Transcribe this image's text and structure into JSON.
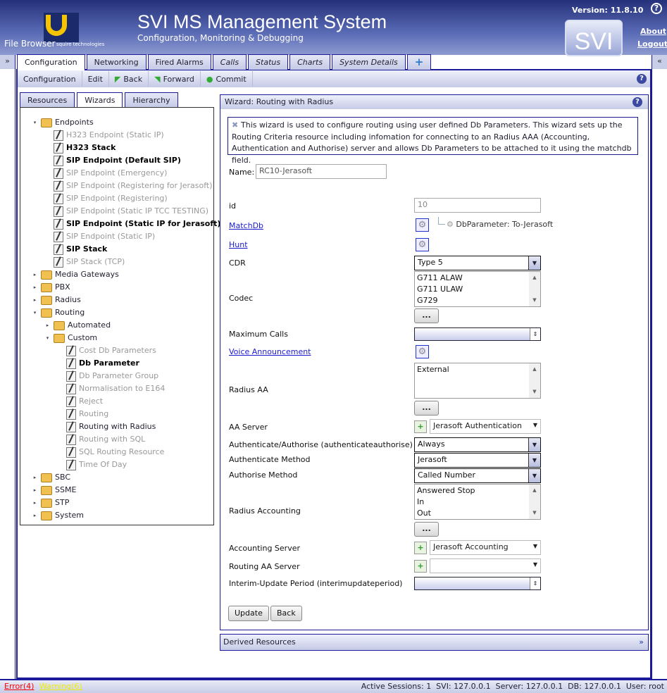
{
  "header": {
    "title": "SVI MS Management System",
    "subtitle": "Configuration, Monitoring & Debugging",
    "file_browser": "File Browser",
    "version": "Version: 11.8.10",
    "about": "About",
    "logout": "Logout",
    "logo_text": "SVI",
    "brand": "squire technologies"
  },
  "gutter": {
    "left": "»",
    "right": "«"
  },
  "tabs": [
    {
      "label": "Configuration"
    },
    {
      "label": "Networking"
    },
    {
      "label": "Fired Alarms"
    },
    {
      "label": "Calls"
    },
    {
      "label": "Status"
    },
    {
      "label": "Charts"
    },
    {
      "label": "System Details"
    },
    {
      "label": "+"
    }
  ],
  "toolbar": {
    "configuration": "Configuration",
    "edit": "Edit",
    "back": "Back",
    "forward": "Forward",
    "commit": "Commit",
    "help": "?"
  },
  "left_tabs": [
    {
      "label": "Resources"
    },
    {
      "label": "Wizards"
    },
    {
      "label": "Hierarchy"
    }
  ],
  "tree": [
    {
      "label": "Endpoints",
      "level": 0,
      "type": "folder",
      "toggle": "▾",
      "style": "dark"
    },
    {
      "label": "H323 Endpoint (Static IP)",
      "level": 1,
      "type": "wizard",
      "style": "grey"
    },
    {
      "label": "H323 Stack",
      "level": 1,
      "type": "wizard",
      "style": "bold"
    },
    {
      "label": "SIP Endpoint (Default SIP)",
      "level": 1,
      "type": "wizard",
      "style": "bold"
    },
    {
      "label": "SIP Endpoint (Emergency)",
      "level": 1,
      "type": "wizard",
      "style": "grey"
    },
    {
      "label": "SIP Endpoint (Registering for Jerasoft)",
      "level": 1,
      "type": "wizard",
      "style": "grey"
    },
    {
      "label": "SIP Endpoint (Registering)",
      "level": 1,
      "type": "wizard",
      "style": "grey"
    },
    {
      "label": "SIP Endpoint (Static IP TCC TESTING)",
      "level": 1,
      "type": "wizard",
      "style": "grey"
    },
    {
      "label": "SIP Endpoint (Static IP for Jerasoft)",
      "level": 1,
      "type": "wizard",
      "style": "bold"
    },
    {
      "label": "SIP Endpoint (Static IP)",
      "level": 1,
      "type": "wizard",
      "style": "grey"
    },
    {
      "label": "SIP Stack",
      "level": 1,
      "type": "wizard",
      "style": "bold"
    },
    {
      "label": "SIP Stack (TCP)",
      "level": 1,
      "type": "wizard",
      "style": "grey"
    },
    {
      "label": "Media Gateways",
      "level": 0,
      "type": "folder",
      "toggle": "▸",
      "style": "dark"
    },
    {
      "label": "PBX",
      "level": 0,
      "type": "folder",
      "toggle": "▸",
      "style": "dark"
    },
    {
      "label": "Radius",
      "level": 0,
      "type": "folder",
      "toggle": "▸",
      "style": "dark"
    },
    {
      "label": "Routing",
      "level": 0,
      "type": "folder",
      "toggle": "▾",
      "style": "dark"
    },
    {
      "label": "Automated",
      "level": 1,
      "type": "folder",
      "toggle": "▸",
      "style": "dark"
    },
    {
      "label": "Custom",
      "level": 1,
      "type": "folder",
      "toggle": "▾",
      "style": "dark"
    },
    {
      "label": "Cost Db Parameters",
      "level": 2,
      "type": "wizard",
      "style": "grey"
    },
    {
      "label": "Db Parameter",
      "level": 2,
      "type": "wizard",
      "style": "bold"
    },
    {
      "label": "Db Parameter Group",
      "level": 2,
      "type": "wizard",
      "style": "grey"
    },
    {
      "label": "Normalisation to E164",
      "level": 2,
      "type": "wizard",
      "style": "grey"
    },
    {
      "label": "Reject",
      "level": 2,
      "type": "wizard",
      "style": "grey"
    },
    {
      "label": "Routing",
      "level": 2,
      "type": "wizard",
      "style": "grey"
    },
    {
      "label": "Routing with Radius",
      "level": 2,
      "type": "wizard",
      "style": "dark"
    },
    {
      "label": "Routing with SQL",
      "level": 2,
      "type": "wizard",
      "style": "grey"
    },
    {
      "label": "SQL Routing Resource",
      "level": 2,
      "type": "wizard",
      "style": "grey"
    },
    {
      "label": "Time Of Day",
      "level": 2,
      "type": "wizard",
      "style": "grey"
    },
    {
      "label": "SBC",
      "level": 0,
      "type": "folder",
      "toggle": "▸",
      "style": "dark"
    },
    {
      "label": "SSME",
      "level": 0,
      "type": "folder",
      "toggle": "▸",
      "style": "dark"
    },
    {
      "label": "STP",
      "level": 0,
      "type": "folder",
      "toggle": "▸",
      "style": "dark"
    },
    {
      "label": "System",
      "level": 0,
      "type": "folder",
      "toggle": "▸",
      "style": "dark"
    }
  ],
  "wizard": {
    "title": "Wizard: Routing with Radius",
    "info": "This wizard is used to configure routing using user defined Db Parameters. This wizard sets up the Routing Criteria resource including infomation for connecting to an Radius AAA (Accounting, Authentication and Authorise) server and allows Db Parameters to be attached to it using the matchdb field.",
    "name_label": "Name:",
    "name_value": "RC10-Jerasoft",
    "id_label": "id",
    "id_value": "10",
    "matchdb_label": "MatchDb",
    "matchdb_child": "DbParameter: To-Jerasoft",
    "hunt_label": "Hunt",
    "cdr_label": "CDR",
    "cdr_value": "Type 5",
    "codec_label": "Codec",
    "codec_options": [
      "G711 ALAW",
      "G711 ULAW",
      "G729"
    ],
    "more": "...",
    "max_calls_label": "Maximum Calls",
    "max_calls_value": "",
    "voice_label": "Voice Announcement",
    "radius_aa_label": "Radius AA",
    "radius_aa_options": [
      "External"
    ],
    "aa_server_label": "AA Server",
    "aa_server_value": "Jerasoft Authentication",
    "authauth_label": "Authenticate/Authorise (authenticateauthorise)",
    "authauth_value": "Always",
    "auth_method_label": "Authenticate Method",
    "auth_method_value": "Jerasoft",
    "authorise_method_label": "Authorise Method",
    "authorise_method_value": "Called Number",
    "radius_acc_label": "Radius Accounting",
    "radius_acc_options": [
      "Answered Stop",
      "In",
      "Out"
    ],
    "acc_server_label": "Accounting Server",
    "acc_server_value": "Jerasoft Accounting",
    "routing_aa_label": "Routing AA Server",
    "routing_aa_value": "",
    "interim_label": "Interim-Update Period (interimupdateperiod)",
    "interim_value": "",
    "update": "Update",
    "back": "Back"
  },
  "derived": {
    "label": "Derived Resources",
    "toggle": "»"
  },
  "status": {
    "error": "Error(4)",
    "warning": "Warning(6)",
    "info": "Active Sessions: 1  SVI: 127.0.0.1  Server: 127.0.0.1  DB: 127.0.0.1  User: root"
  },
  "colors": {
    "accent": "#1a1a9a",
    "error": "#ff0000",
    "warning": "#ffff00",
    "link": "#1a1acc"
  }
}
